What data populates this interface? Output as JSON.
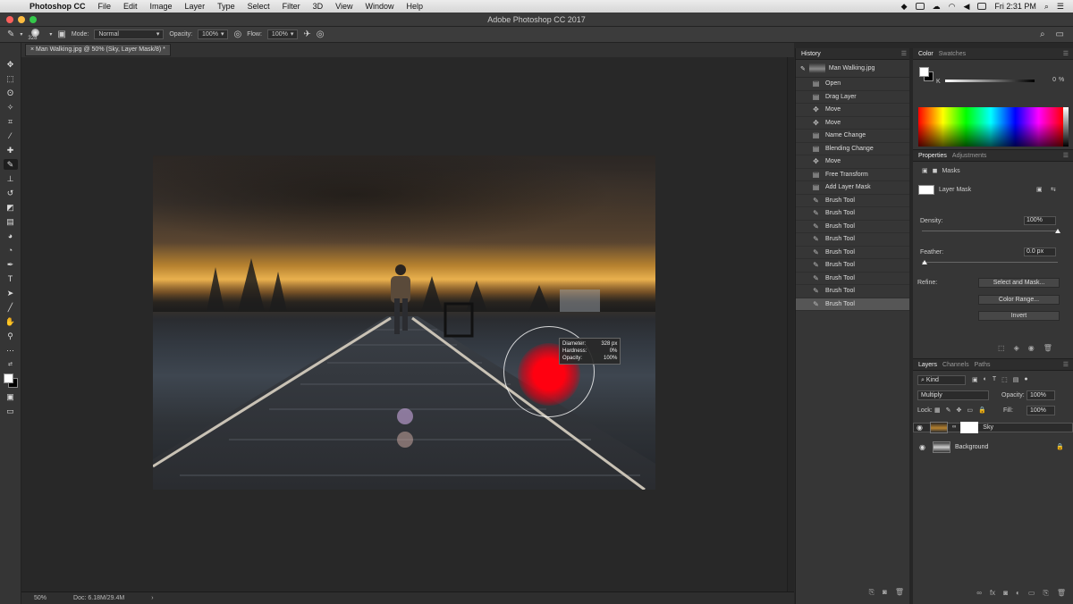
{
  "menubar": {
    "app_name": "Photoshop CC",
    "items": [
      "File",
      "Edit",
      "Image",
      "Layer",
      "Type",
      "Select",
      "Filter",
      "3D",
      "View",
      "Window",
      "Help"
    ],
    "clock": "Fri 2:31 PM"
  },
  "titlebar": {
    "title": "Adobe Photoshop CC 2017"
  },
  "options": {
    "brush_size": "328",
    "mode_label": "Mode:",
    "mode_value": "Normal",
    "opacity_label": "Opacity:",
    "opacity_value": "100%",
    "flow_label": "Flow:",
    "flow_value": "100%"
  },
  "document": {
    "tab_title": "Man Walking.jpg @ 50% (Sky, Layer Mask/8) *",
    "zoom": "50%",
    "doc_size": "Doc: 6.18M/29.4M"
  },
  "brush_tooltip": {
    "diameter_label": "Diameter:",
    "diameter_value": "328 px",
    "hardness_label": "Hardness:",
    "hardness_value": "0%",
    "opacity_label": "Opacity:",
    "opacity_value": "100%"
  },
  "history": {
    "title": "History",
    "snapshot": "Man Walking.jpg",
    "items": [
      {
        "label": "Open",
        "icon": "doc-icon"
      },
      {
        "label": "Drag Layer",
        "icon": "doc-icon"
      },
      {
        "label": "Move",
        "icon": "move-icon"
      },
      {
        "label": "Move",
        "icon": "move-icon"
      },
      {
        "label": "Name Change",
        "icon": "doc-icon"
      },
      {
        "label": "Blending Change",
        "icon": "doc-icon"
      },
      {
        "label": "Move",
        "icon": "move-icon"
      },
      {
        "label": "Free Transform",
        "icon": "doc-icon"
      },
      {
        "label": "Add Layer Mask",
        "icon": "doc-icon"
      },
      {
        "label": "Brush Tool",
        "icon": "brush-icon"
      },
      {
        "label": "Brush Tool",
        "icon": "brush-icon"
      },
      {
        "label": "Brush Tool",
        "icon": "brush-icon"
      },
      {
        "label": "Brush Tool",
        "icon": "brush-icon"
      },
      {
        "label": "Brush Tool",
        "icon": "brush-icon"
      },
      {
        "label": "Brush Tool",
        "icon": "brush-icon"
      },
      {
        "label": "Brush Tool",
        "icon": "brush-icon"
      },
      {
        "label": "Brush Tool",
        "icon": "brush-icon"
      },
      {
        "label": "Brush Tool",
        "icon": "brush-icon"
      }
    ],
    "selected_index": 17
  },
  "color": {
    "tabs": [
      "Color",
      "Swatches"
    ],
    "channel": "K",
    "value": "0",
    "unit": "%"
  },
  "properties": {
    "tabs": [
      "Properties",
      "Adjustments"
    ],
    "section": "Masks",
    "mask_label": "Layer Mask",
    "density_label": "Density:",
    "density_value": "100%",
    "density_level": 1.0,
    "feather_label": "Feather:",
    "feather_value": "0.0 px",
    "feather_level": 0.0,
    "refine_label": "Refine:",
    "btn_select_mask": "Select and Mask...",
    "btn_color_range": "Color Range...",
    "btn_invert": "Invert"
  },
  "layers": {
    "tabs": [
      "Layers",
      "Channels",
      "Paths"
    ],
    "filter": "Kind",
    "blend_mode": "Multiply",
    "opacity_label": "Opacity:",
    "opacity_value": "100%",
    "lock_label": "Lock:",
    "fill_label": "Fill:",
    "fill_value": "100%",
    "items": [
      {
        "name": "Sky",
        "selected": true
      },
      {
        "name": "Background",
        "selected": false
      }
    ]
  },
  "colors": {
    "selection": "#565656",
    "brush_paint": "#ff0010"
  }
}
